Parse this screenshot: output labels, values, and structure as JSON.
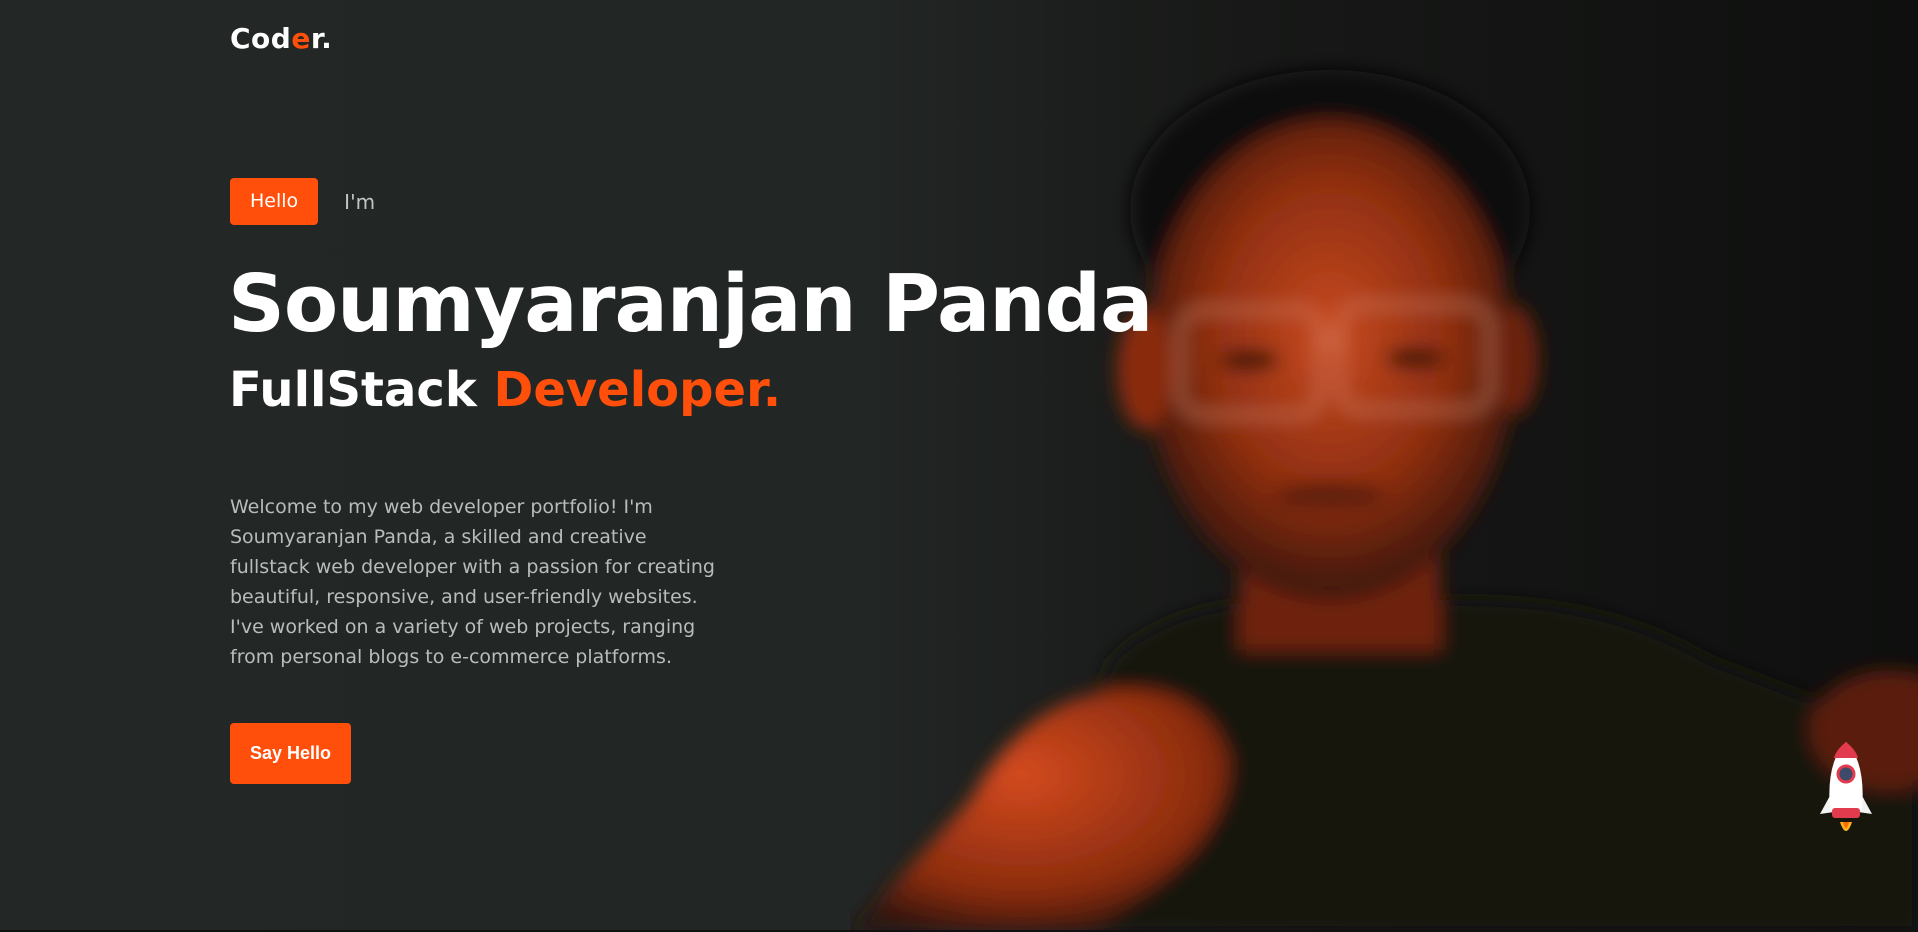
{
  "header": {
    "logo": {
      "part1": "Cod",
      "accent": "e",
      "part2": "r."
    }
  },
  "hero": {
    "hello_badge": "Hello",
    "im": "I'm",
    "name": "Soumyaranjan Panda",
    "role_main": "FullStack",
    "role_accent": "Developer.",
    "intro": "Welcome to my web developer portfolio! I'm Soumyaranjan Panda, a skilled and creative fullstack web developer with a passion for creating beautiful, responsive, and user-friendly websites. I've worked on a variety of web projects, ranging from personal blogs to e-commerce platforms.",
    "cta_label": "Say Hello",
    "portrait_icon": "person-portrait"
  },
  "scroll_to_top": {
    "icon": "rocket-icon"
  },
  "colors": {
    "accent": "#ff4f0a",
    "background": "#222624",
    "text": "#ffffff",
    "muted_text": "#b9bcbc"
  }
}
